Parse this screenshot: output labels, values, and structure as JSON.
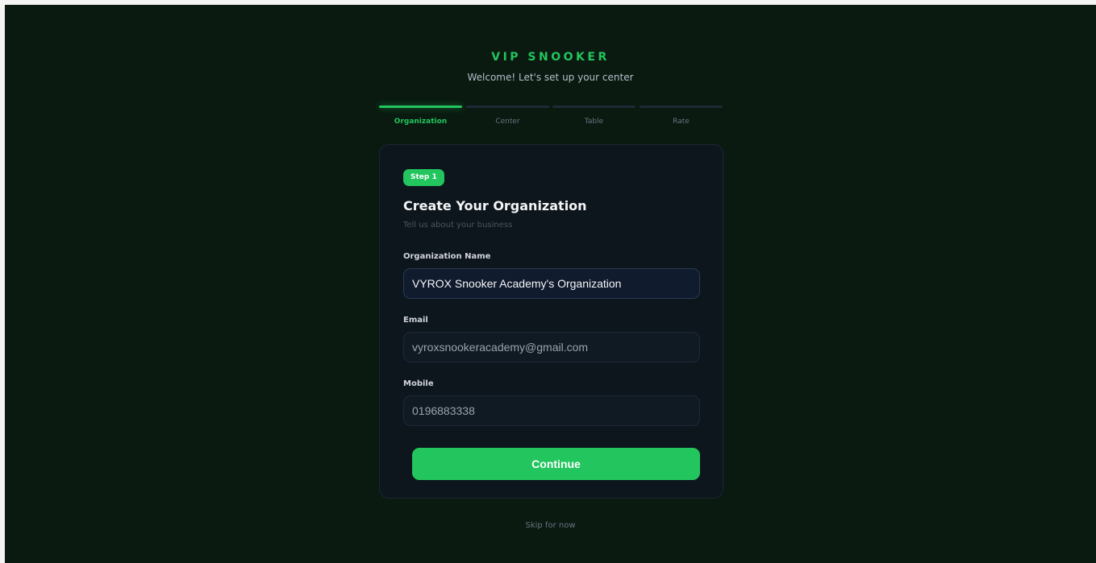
{
  "header": {
    "brand": "VIP SNOOKER",
    "welcome": "Welcome! Let's set up your center"
  },
  "stepper": {
    "steps": [
      {
        "label": "Organization",
        "active": true
      },
      {
        "label": "Center",
        "active": false
      },
      {
        "label": "Table",
        "active": false
      },
      {
        "label": "Rate",
        "active": false
      }
    ]
  },
  "card": {
    "badge": "Step 1",
    "title": "Create Your Organization",
    "subtitle": "Tell us about your business",
    "fields": {
      "org_name": {
        "label": "Organization Name",
        "value": "VYROX Snooker Academy's Organization"
      },
      "email": {
        "label": "Email",
        "value": "vyroxsnookeracademy@gmail.com"
      },
      "mobile": {
        "label": "Mobile",
        "value": "0196883338"
      }
    },
    "continue_label": "Continue"
  },
  "footer": {
    "skip_label": "Skip for now"
  },
  "colors": {
    "accent": "#22c55e",
    "background": "#0a1a10",
    "card": "#0d161c"
  }
}
